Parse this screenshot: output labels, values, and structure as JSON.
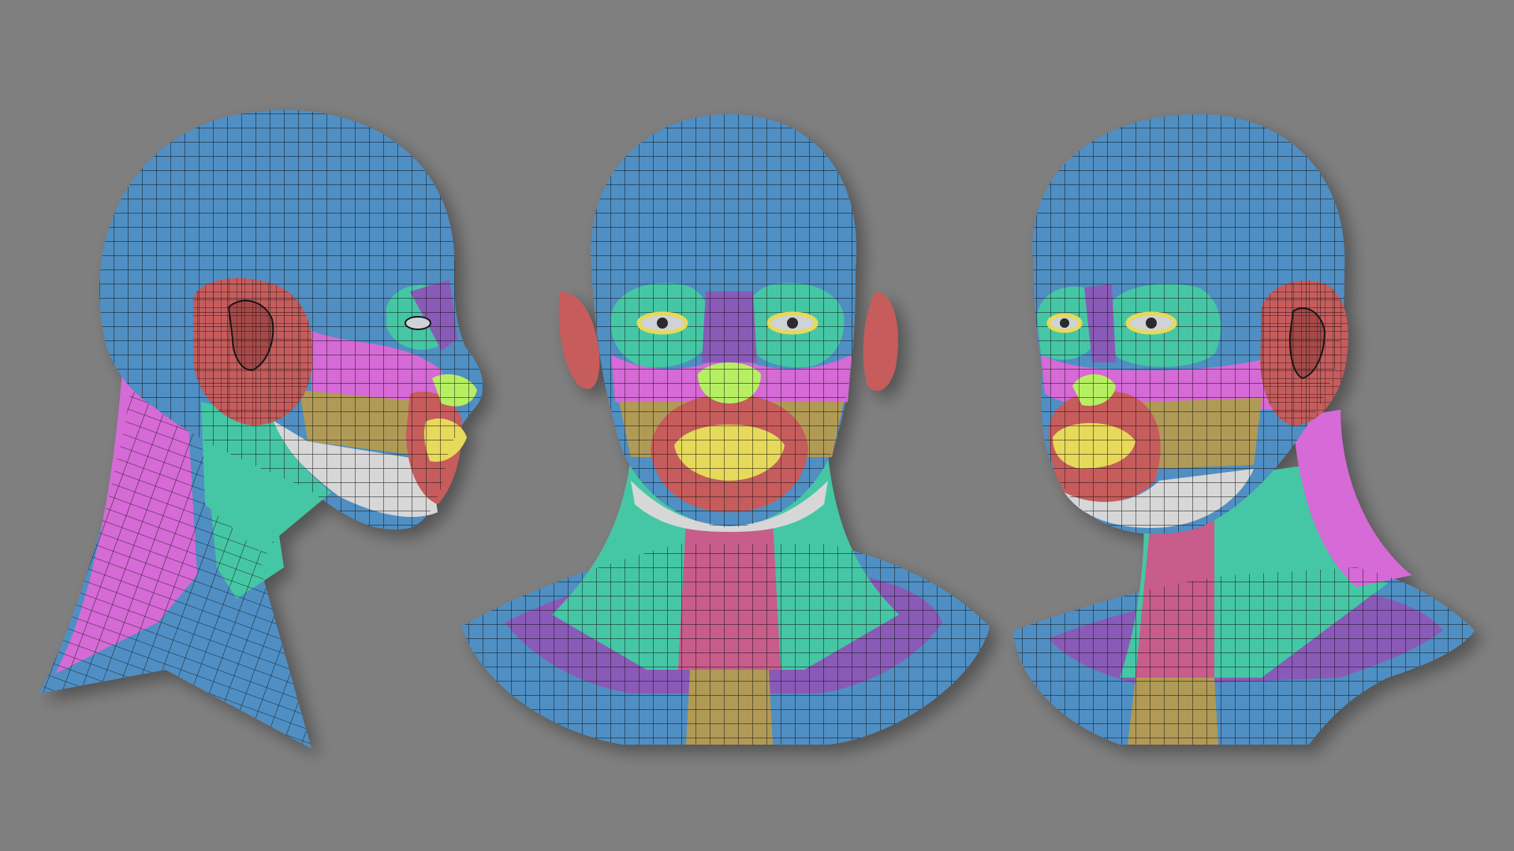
{
  "background_color": "#7f7f7f",
  "palette": {
    "skull": "#4f8fc4",
    "eye_ring": "#45c7a5",
    "brow_band": "#8a5ab8",
    "cheek_band": "#d66ad6",
    "ear": "#c75b5b",
    "mouth_ring": "#c75b5b",
    "lips": "#e7d95a",
    "nose": "#b7ef63",
    "jaw_band": "#b19a57",
    "chin_band": "#d7d7d7",
    "neck_front": "#c85b8a",
    "neck_side": "#45c7a5",
    "collar": "#8a5ab8",
    "wire": "#151515"
  },
  "views": [
    {
      "name": "side-view",
      "description_icon": "head-profile-icon"
    },
    {
      "name": "front-view",
      "description_icon": "head-front-icon"
    },
    {
      "name": "three-quarter-view",
      "description_icon": "head-three-quarter-icon"
    }
  ]
}
